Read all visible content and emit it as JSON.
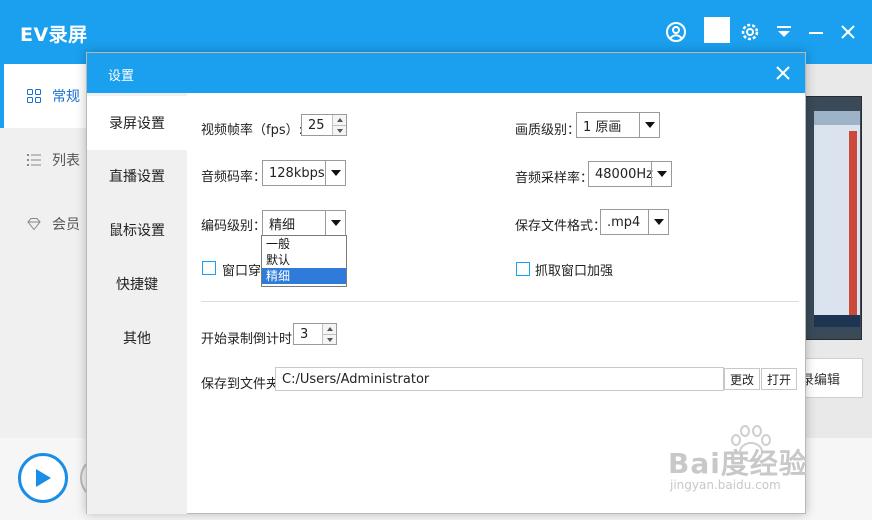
{
  "app": {
    "title": "EV录屏",
    "sidebar": [
      {
        "label": "常规",
        "icon": "grid-icon"
      },
      {
        "label": "列表",
        "icon": "list-icon"
      },
      {
        "label": "会员",
        "icon": "diamond-icon"
      }
    ],
    "edit_label": "录编辑",
    "colors": {
      "accent": "#1aa0ee",
      "selection": "#2f7bd9"
    }
  },
  "dialog": {
    "title": "设置",
    "nav": [
      "录屏设置",
      "直播设置",
      "鼠标设置",
      "快捷键",
      "其他"
    ],
    "active_nav": 0,
    "fps_label": "视频帧率（fps）:",
    "fps_value": "25",
    "quality_label": "画质级别：",
    "quality_value": "1 原画",
    "audio_bitrate_label": "音频码率：",
    "audio_bitrate_value": "128kbps",
    "sample_rate_label": "音频采样率：",
    "sample_rate_value": "48000Hz",
    "encode_label": "编码级别：",
    "encode_value": "精细",
    "format_label": "保存文件格式：",
    "format_value": ".mp4",
    "encode_options": [
      "一般",
      "默认",
      "精细"
    ],
    "encode_selected_index": 2,
    "window_through_label": "窗口穿透",
    "capture_enhance_label": "抓取窗口加强",
    "countdown_label": "开始录制倒计时:",
    "countdown_value": "3",
    "save_folder_label": "保存到文件夹:",
    "save_folder_value": "C:/Users/Administrator",
    "change_btn": "更改",
    "open_btn": "打开"
  },
  "watermark": {
    "main": "Bai度经验",
    "sub": "jingyan.baidu.com"
  }
}
